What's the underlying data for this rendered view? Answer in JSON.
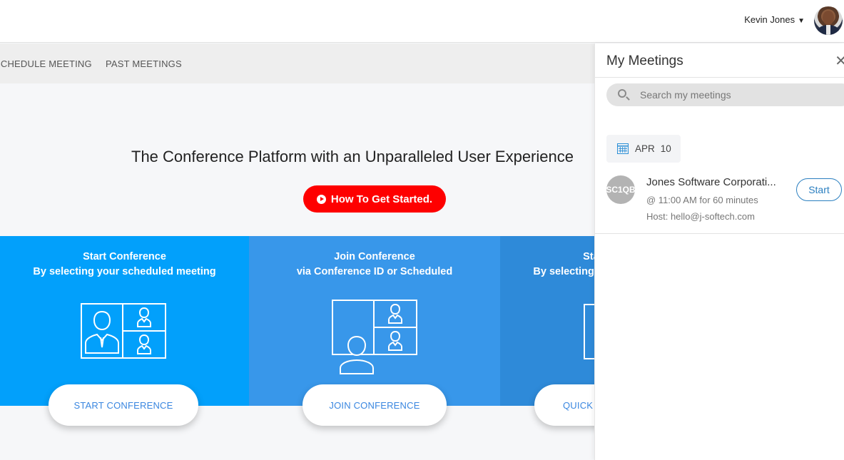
{
  "header": {
    "user_name": "Kevin Jones",
    "user_caret": "▼"
  },
  "nav": {
    "items": [
      {
        "label": "SCHEDULE MEETING"
      },
      {
        "label": "PAST MEETINGS"
      }
    ]
  },
  "hero": {
    "title": "The Conference Platform with an Unparalleled User Experience",
    "cta_label": "How To Get Started."
  },
  "cards": [
    {
      "title_line1": "Start Conference",
      "title_line2": "By selecting your scheduled meeting",
      "button_label": "START CONFERENCE"
    },
    {
      "title_line1": "Join Conference",
      "title_line2": "via Conference ID or Scheduled",
      "button_label": "JOIN CONFERENCE"
    },
    {
      "title_line1": "Start Conference",
      "title_line2": "By selecting your scheduled meeting",
      "button_label": "QUICK CONFERENCE"
    }
  ],
  "panel": {
    "title": "My Meetings",
    "close_glyph": "✕",
    "search_placeholder": "Search my meetings",
    "search_value": "",
    "date": {
      "month": "APR",
      "day": "10"
    },
    "meetings": [
      {
        "avatar_text": "SC1QB",
        "name": "Jones Software Corporati...",
        "time": "@ 11:00 AM for 60 minutes",
        "host": "Host: hello@j-softech.com",
        "start_label": "Start"
      }
    ]
  }
}
